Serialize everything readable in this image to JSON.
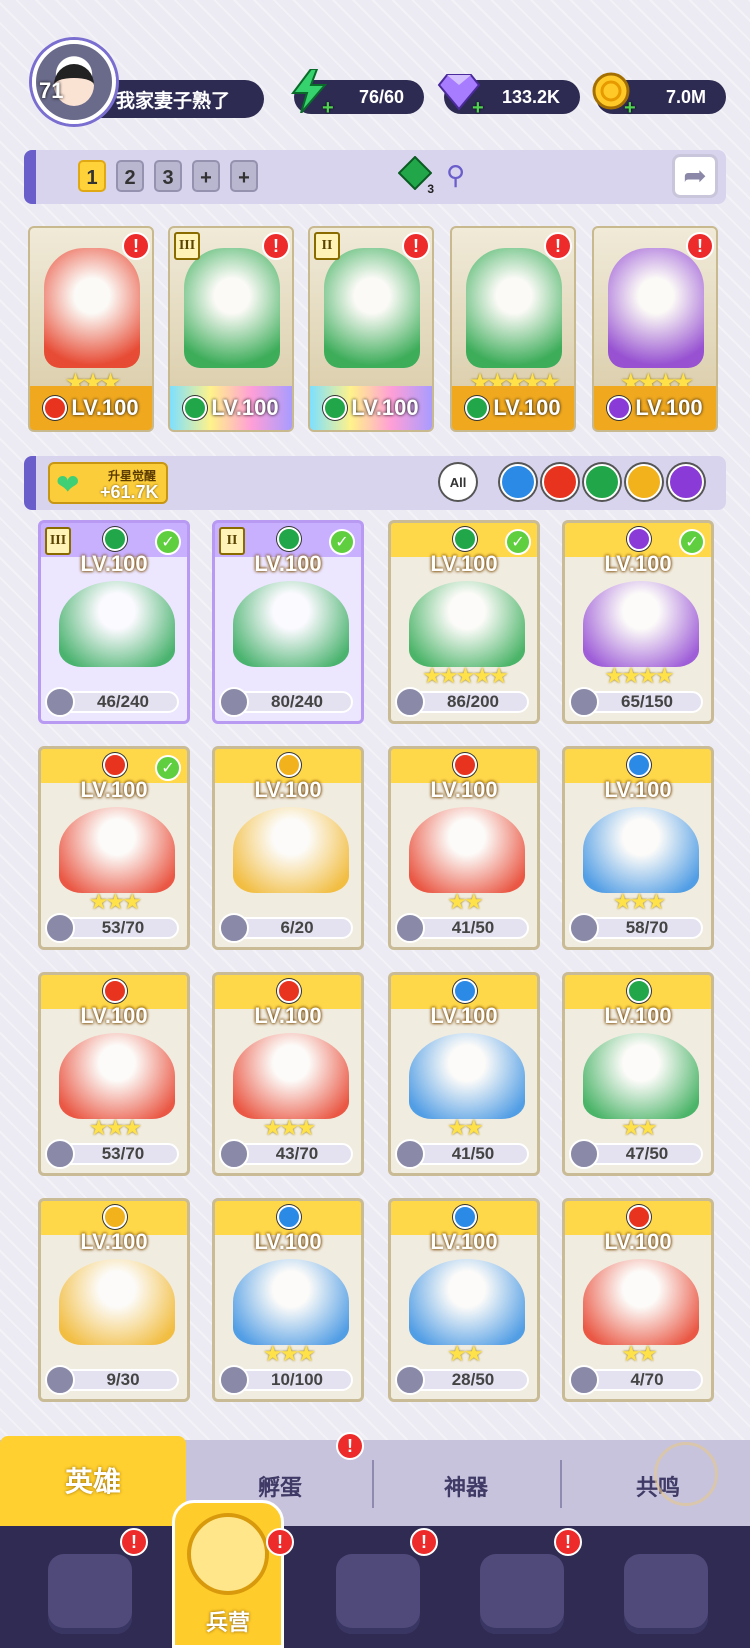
{
  "player": {
    "level": "71",
    "name": "我家妻子熟了"
  },
  "resources": [
    {
      "name": "energy",
      "value": "76/60",
      "icon": "lightning-icon"
    },
    {
      "name": "diamond",
      "value": "133.2K",
      "icon": "diamond-icon"
    },
    {
      "name": "gold",
      "value": "7.0M",
      "icon": "coin-icon"
    }
  ],
  "team_slots": [
    "1",
    "2",
    "3",
    "+",
    "+"
  ],
  "team_gem_badge": "3",
  "team": [
    {
      "level": "LV.100",
      "stars": "★★★",
      "element": "fire",
      "rank": "",
      "alert": "!"
    },
    {
      "level": "LV.100",
      "stars": "",
      "element": "wind",
      "rank": "III",
      "alert": "!"
    },
    {
      "level": "LV.100",
      "stars": "",
      "element": "wind",
      "rank": "II",
      "alert": "!"
    },
    {
      "level": "LV.100",
      "stars": "★★★★★",
      "element": "wind",
      "rank": "",
      "alert": "!"
    },
    {
      "level": "LV.100",
      "stars": "★★★★",
      "element": "dark",
      "rank": "",
      "alert": "!"
    }
  ],
  "awaken": {
    "label": "升星觉醒",
    "value": "+61.7K"
  },
  "filters": [
    "All",
    "water",
    "fire",
    "wind",
    "light",
    "dark"
  ],
  "heroes": [
    {
      "level": "LV.100",
      "stars": "",
      "shards": "46/240",
      "element": "wind",
      "rank": "III",
      "check": true,
      "purple": true
    },
    {
      "level": "LV.100",
      "stars": "",
      "shards": "80/240",
      "element": "wind",
      "rank": "II",
      "check": true,
      "purple": true
    },
    {
      "level": "LV.100",
      "stars": "★★★★★",
      "shards": "86/200",
      "element": "wind",
      "rank": "",
      "check": true,
      "purple": false
    },
    {
      "level": "LV.100",
      "stars": "★★★★",
      "shards": "65/150",
      "element": "dark",
      "rank": "",
      "check": true,
      "purple": false
    },
    {
      "level": "LV.100",
      "stars": "★★★",
      "shards": "53/70",
      "element": "fire",
      "rank": "",
      "check": true,
      "purple": false
    },
    {
      "level": "LV.100",
      "stars": "",
      "shards": "6/20",
      "element": "light",
      "rank": "",
      "check": false,
      "purple": false
    },
    {
      "level": "LV.100",
      "stars": "★★",
      "shards": "41/50",
      "element": "fire",
      "rank": "",
      "check": false,
      "purple": false
    },
    {
      "level": "LV.100",
      "stars": "★★★",
      "shards": "58/70",
      "element": "water",
      "rank": "",
      "check": false,
      "purple": false
    },
    {
      "level": "LV.100",
      "stars": "★★★",
      "shards": "53/70",
      "element": "fire",
      "rank": "",
      "check": false,
      "purple": false
    },
    {
      "level": "LV.100",
      "stars": "★★★",
      "shards": "43/70",
      "element": "fire",
      "rank": "",
      "check": false,
      "purple": false
    },
    {
      "level": "LV.100",
      "stars": "★★",
      "shards": "41/50",
      "element": "water",
      "rank": "",
      "check": false,
      "purple": false
    },
    {
      "level": "LV.100",
      "stars": "★★",
      "shards": "47/50",
      "element": "wind",
      "rank": "",
      "check": false,
      "purple": false
    },
    {
      "level": "LV.100",
      "stars": "",
      "shards": "9/30",
      "element": "light",
      "rank": "",
      "check": false,
      "purple": false
    },
    {
      "level": "LV.100",
      "stars": "★★★",
      "shards": "10/100",
      "element": "water",
      "rank": "",
      "check": false,
      "purple": false
    },
    {
      "level": "LV.100",
      "stars": "★★",
      "shards": "28/50",
      "element": "water",
      "rank": "",
      "check": false,
      "purple": false
    },
    {
      "level": "LV.100",
      "stars": "★★",
      "shards": "4/70",
      "element": "fire",
      "rank": "",
      "check": false,
      "purple": false
    }
  ],
  "sub_tabs": [
    "英雄",
    "孵蛋",
    "神器",
    "共鸣"
  ],
  "nav_active_label": "兵营",
  "alert_symbol": "!",
  "colors": {
    "fire": "#e8331e",
    "water": "#2a8ae6",
    "wind": "#21a64a",
    "light": "#f2b21b",
    "dark": "#8a3ad6",
    "accent": "#ffd02f",
    "nav": "#2f2b52"
  }
}
